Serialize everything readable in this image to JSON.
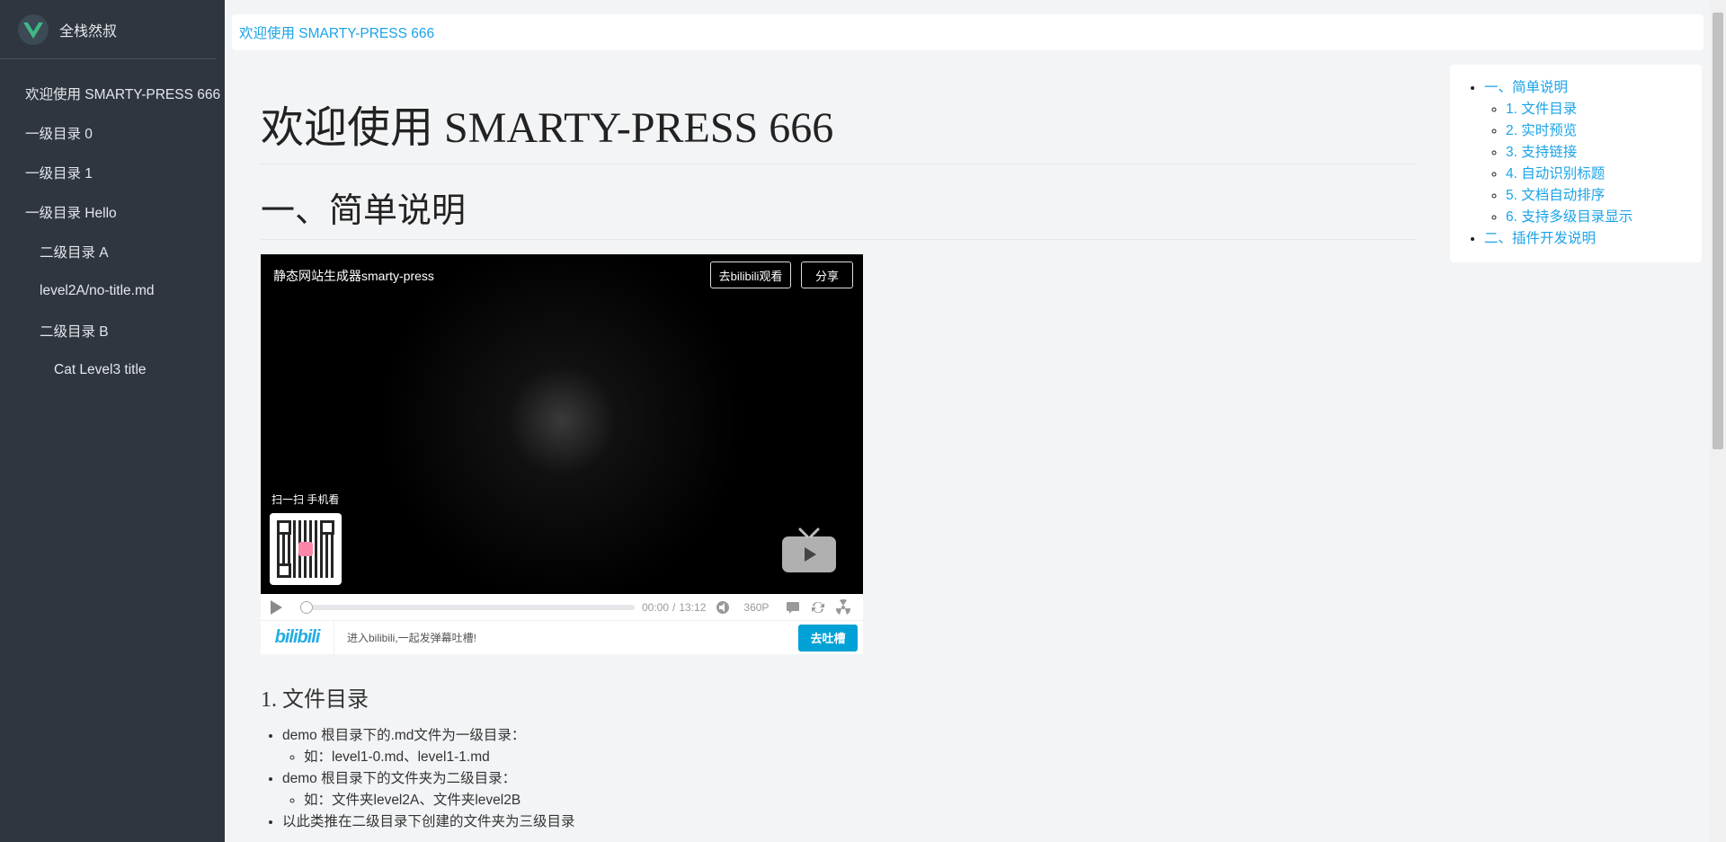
{
  "brand": {
    "name": "全栈然叔"
  },
  "sidebar": {
    "items": [
      {
        "label": "欢迎使用 SMARTY-PRESS 666",
        "level": 1
      },
      {
        "label": "一级目录 0",
        "level": 1
      },
      {
        "label": "一级目录 1",
        "level": 1
      },
      {
        "label": "一级目录 Hello",
        "level": 1
      },
      {
        "label": "二级目录 A",
        "level": 2
      },
      {
        "label": "level2A/no-title.md",
        "level": 2
      },
      {
        "label": "二级目录 B",
        "level": 2
      },
      {
        "label": "Cat Level3 title",
        "level": 3
      }
    ]
  },
  "breadcrumb": {
    "current": "欢迎使用 SMARTY-PRESS 666"
  },
  "article": {
    "title": "欢迎使用 SMARTY-PRESS 666",
    "section1": "一、简单说明",
    "subsection1": "1. 文件目录",
    "points": [
      "demo 根目录下的.md文件为一级目录：",
      "如：level1-0.md、level1-1.md",
      "demo 根目录下的文件夹为二级目录：",
      "如：文件夹level2A、文件夹level2B",
      "以此类推在二级目录下创建的文件夹为三级目录"
    ]
  },
  "player": {
    "title": "静态网站生成器smarty-press",
    "bili_button": "去bilibili观看",
    "share_button": "分享",
    "scan_label": "扫一扫 手机看",
    "time_current": "00:00",
    "time_separator": "/",
    "time_total": "13:12",
    "quality": "360P",
    "progress": 0,
    "logo_text": "bilibili",
    "bar_text": "进入bilibili,一起发弹幕吐槽!",
    "bar_button": "去吐槽"
  },
  "toc": {
    "sections": [
      {
        "label": "一、简单说明",
        "children": [
          "1. 文件目录",
          "2. 实时预览",
          "3. 支持链接",
          "4. 自动识别标题",
          "5. 文档自动排序",
          "6. 支持多级目录显示"
        ]
      },
      {
        "label": "二、插件开发说明",
        "children": []
      }
    ]
  },
  "colors": {
    "sidebar_bg": "#2f3640",
    "link": "#1aa3e8",
    "bili_blue": "#00a1d6",
    "vue_green": "#41b883"
  }
}
